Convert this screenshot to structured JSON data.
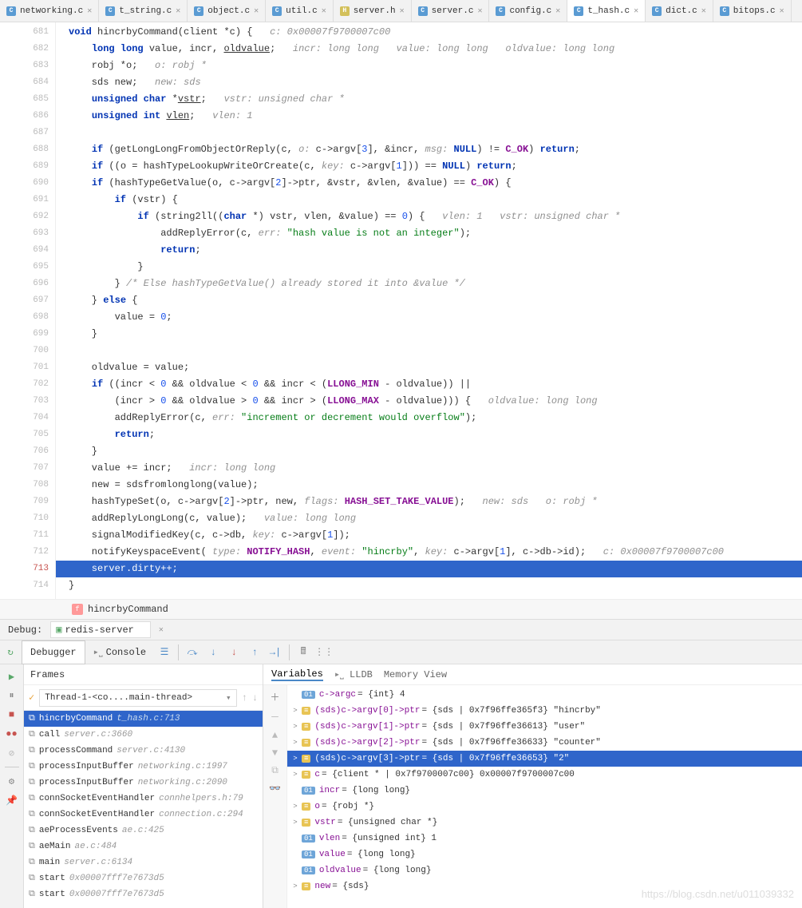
{
  "tabs": [
    {
      "name": "networking.c",
      "type": "c"
    },
    {
      "name": "t_string.c",
      "type": "c"
    },
    {
      "name": "object.c",
      "type": "c"
    },
    {
      "name": "util.c",
      "type": "c"
    },
    {
      "name": "server.h",
      "type": "h"
    },
    {
      "name": "server.c",
      "type": "c"
    },
    {
      "name": "config.c",
      "type": "c"
    },
    {
      "name": "t_hash.c",
      "type": "c",
      "active": true
    },
    {
      "name": "dict.c",
      "type": "c"
    },
    {
      "name": "bitops.c",
      "type": "c"
    }
  ],
  "gutter": {
    "start": 681,
    "end": 714,
    "exec_line": 713
  },
  "breadcrumb": {
    "fn": "hincrbyCommand"
  },
  "debug": {
    "label": "Debug:",
    "config": "redis-server",
    "tabs": {
      "debugger": "Debugger",
      "console": "Console"
    },
    "frames_title": "Frames",
    "thread": "Thread-1-<co....main-thread>",
    "frames": [
      {
        "name": "hincrbyCommand",
        "loc": "t_hash.c:713",
        "sel": true
      },
      {
        "name": "call",
        "loc": "server.c:3660"
      },
      {
        "name": "processCommand",
        "loc": "server.c:4130"
      },
      {
        "name": "processInputBuffer",
        "loc": "networking.c:1997"
      },
      {
        "name": "processInputBuffer",
        "loc": "networking.c:2090"
      },
      {
        "name": "connSocketEventHandler",
        "loc": "connhelpers.h:79"
      },
      {
        "name": "connSocketEventHandler",
        "loc": "connection.c:294"
      },
      {
        "name": "aeProcessEvents",
        "loc": "ae.c:425"
      },
      {
        "name": "aeMain",
        "loc": "ae.c:484"
      },
      {
        "name": "main",
        "loc": "server.c:6134"
      },
      {
        "name": "start",
        "loc": "0x00007fff7e7673d5"
      },
      {
        "name": "start",
        "loc": "0x00007fff7e7673d5"
      }
    ],
    "vars_tabs": {
      "variables": "Variables",
      "lldb": "LLDB",
      "memory": "Memory View"
    },
    "vars": [
      {
        "chev": "",
        "badge": "01",
        "name": "c->argc",
        "val": " = {int} 4"
      },
      {
        "chev": ">",
        "badge": "≡",
        "name": "(sds)c->argv[0]->ptr",
        "val": " = {sds | 0x7f96ffe365f3} \"hincrby\""
      },
      {
        "chev": ">",
        "badge": "≡",
        "name": "(sds)c->argv[1]->ptr",
        "val": " = {sds | 0x7f96ffe36613} \"user\""
      },
      {
        "chev": ">",
        "badge": "≡",
        "name": "(sds)c->argv[2]->ptr",
        "val": " = {sds | 0x7f96ffe36633} \"counter\""
      },
      {
        "chev": ">",
        "badge": "≡",
        "name": "(sds)c->argv[3]->ptr",
        "val": " = {sds | 0x7f96ffe36653} \"2\"",
        "sel": true
      },
      {
        "chev": ">",
        "badge": "≡",
        "name": "c",
        "val": " = {client * | 0x7f9700007c00} 0x00007f9700007c00"
      },
      {
        "chev": "",
        "badge": "01",
        "name": "incr",
        "val": " = {long long}"
      },
      {
        "chev": ">",
        "badge": "≡",
        "name": "o",
        "val": " = {robj *}"
      },
      {
        "chev": ">",
        "badge": "≡",
        "name": "vstr",
        "val": " = {unsigned char *}"
      },
      {
        "chev": "",
        "badge": "01",
        "name": "vlen",
        "val": " = {unsigned int} 1"
      },
      {
        "chev": "",
        "badge": "01",
        "name": "value",
        "val": " = {long long}"
      },
      {
        "chev": "",
        "badge": "01",
        "name": "oldvalue",
        "val": " = {long long}"
      },
      {
        "chev": ">",
        "badge": "≡",
        "name": "new",
        "val": " = {sds}"
      }
    ]
  },
  "watermark": "https://blog.csdn.net/u011039332"
}
